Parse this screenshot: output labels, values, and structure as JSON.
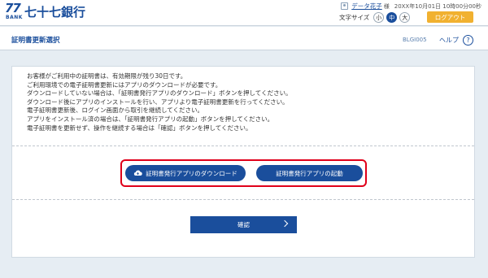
{
  "header": {
    "logo_mark": "77",
    "logo_sub": "BANK",
    "bank_name": "七十七銀行",
    "user_name": "データ花子",
    "user_suffix": "様",
    "login_time": "20XX年10月01日 10時00分00秒",
    "font_size_label": "文字サイズ",
    "font_sizes": [
      "小",
      "中",
      "大"
    ],
    "font_size_selected": "中",
    "logout_label": "ログアウト"
  },
  "titlebar": {
    "title": "証明書更新選択",
    "screen_id": "BLGI005",
    "help_label": "ヘルプ",
    "help_icon": "?"
  },
  "main": {
    "message_lines": [
      "お客様がご利用中の証明書は、有効期限が残り30日です。",
      "ご利用環境での電子証明書更新にはアプリのダウンロードが必要です。",
      "ダウンロードしていない場合は、「証明書発行アプリのダウンロード」ボタンを押してください。",
      "ダウンロード後にアプリのインストールを行い、アプリより電子証明書更新を行ってください。",
      "電子証明書更新後、ログイン画面から取引を継続してください。",
      "アプリをインストール済の場合は、「証明書発行アプリの起動」ボタンを押してください。",
      "電子証明書を更新せず、操作を継続する場合は「確認」ボタンを押してください。"
    ],
    "download_button": "証明書発行アプリのダウンロード",
    "launch_button": "証明書発行アプリの起動",
    "confirm_button": "確認"
  },
  "colors": {
    "primary": "#1a4e9c",
    "logout": "#f1b130",
    "highlight": "#e0001a",
    "background": "#e6edf3"
  }
}
